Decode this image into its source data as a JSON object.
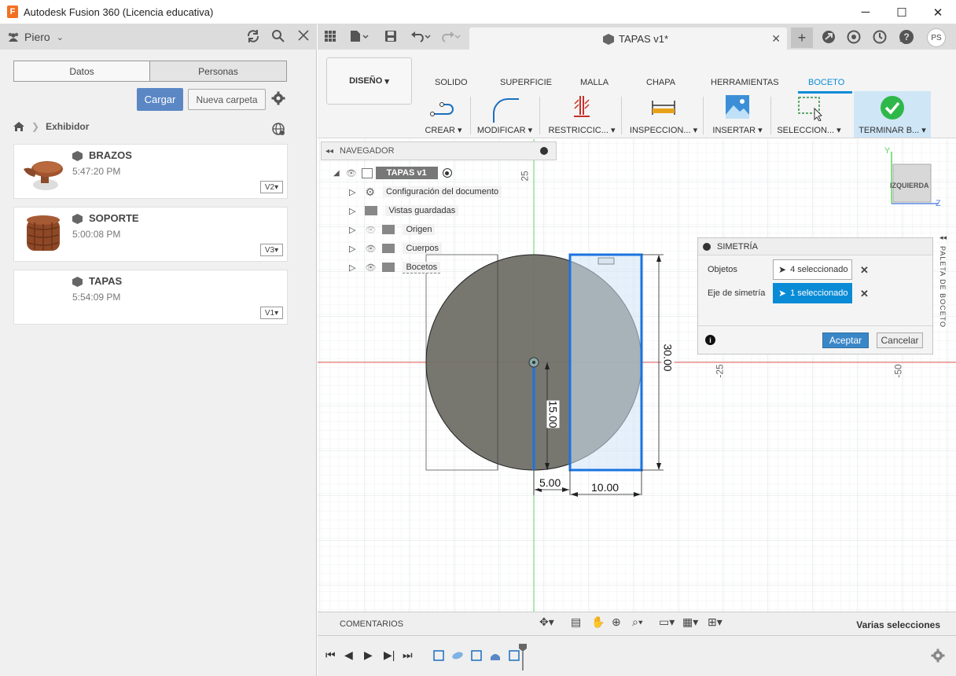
{
  "window": {
    "title": "Autodesk Fusion 360 (Licencia educativa)",
    "icon_letter": "F",
    "minimize_glyph": "─",
    "maximize_glyph": "☐",
    "close_glyph": "✕"
  },
  "data_panel": {
    "user": "Piero",
    "tabs": [
      "Datos",
      "Personas"
    ],
    "upload_label": "Cargar",
    "new_folder_label": "Nueva carpeta",
    "breadcrumb": "Exhibidor",
    "files": [
      {
        "name": "BRAZOS",
        "time": "5:47:20 PM",
        "version": "V2"
      },
      {
        "name": "SOPORTE",
        "time": "5:00:08 PM",
        "version": "V3"
      },
      {
        "name": "TAPAS",
        "time": "5:54:09 PM",
        "version": "V1"
      }
    ]
  },
  "document": {
    "tab_title": "TAPAS v1*",
    "avatar_initials": "PS"
  },
  "ribbon": {
    "workspace_label": "DISEÑO",
    "tabs": [
      "SOLIDO",
      "SUPERFICIE",
      "MALLA",
      "CHAPA",
      "HERRAMIENTAS",
      "BOCETO"
    ],
    "active_tab": "BOCETO",
    "groups": [
      "CREAR",
      "MODIFICAR",
      "RESTRICCIC...",
      "INSPECCION...",
      "INSERTAR",
      "SELECCION...",
      "TERMINAR B..."
    ]
  },
  "navigator": {
    "title": "NAVEGADOR",
    "root": "TAPAS v1",
    "items": [
      "Configuración del documento",
      "Vistas guardadas",
      "Origen",
      "Cuerpos",
      "Bocetos"
    ]
  },
  "sketch": {
    "axis_label_25_top": "25",
    "axis_label_neg25": "-25",
    "axis_label_neg50": "-50",
    "dim_30": "30.00",
    "dim_15": "15.00",
    "dim_5": "5.00",
    "dim_10": "10.00"
  },
  "viewcube": {
    "face": "IZQUIERDA",
    "y_axis": "Y",
    "z_axis": "Z"
  },
  "symmetry_dialog": {
    "title": "SIMETRÍA",
    "objects_label": "Objetos",
    "objects_value": "4 seleccionado",
    "axis_label": "Eje de simetría",
    "axis_value": "1 seleccionado",
    "ok_label": "Aceptar",
    "cancel_label": "Cancelar"
  },
  "palette_tab": "PALETA DE BOCETO",
  "bottom": {
    "comments_label": "COMENTARIOS",
    "status": "Varias selecciones"
  },
  "colors": {
    "accent_blue": "#0a8bd6",
    "upload_button": "#5b87c5",
    "axis_red": "#e0574f",
    "axis_green": "#5fd35f",
    "check_green": "#2fb84a",
    "fusion_orange": "#f37021"
  }
}
